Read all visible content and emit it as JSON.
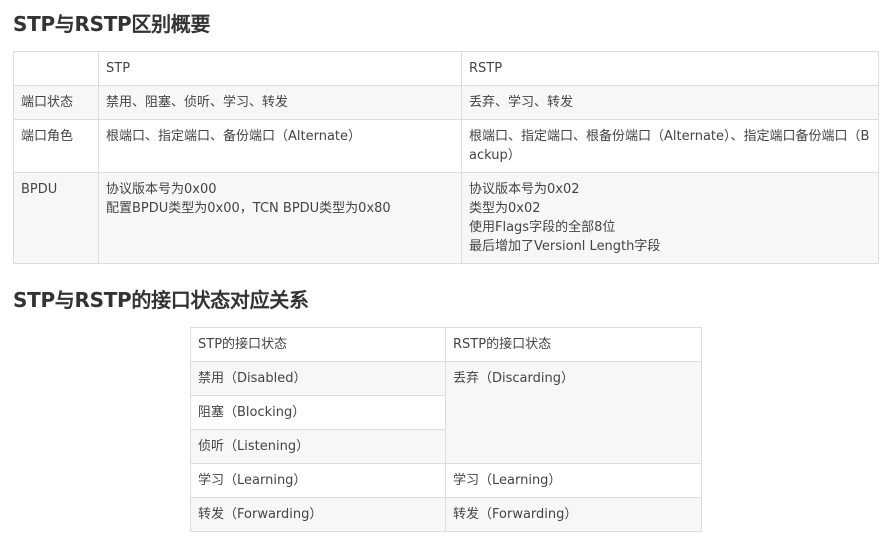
{
  "title1": "STP与RSTP区别概要",
  "title2": "STP与RSTP的接口状态对应关系",
  "table1": {
    "header": [
      "",
      "STP",
      "RSTP"
    ],
    "rows": [
      {
        "label": "端口状态",
        "stp": [
          "禁用、阻塞、侦听、学习、转发"
        ],
        "rstp": [
          "丢弃、学习、转发"
        ]
      },
      {
        "label": "端口角色",
        "stp": [
          "根端口、指定端口、备份端口（Alternate）"
        ],
        "rstp": [
          "根端口、指定端口、根备份端口（Alternate）、指定端口备份端口（Backup）"
        ]
      },
      {
        "label": "BPDU",
        "stp": [
          "协议版本号为0x00",
          "配置BPDU类型为0x00，TCN BPDU类型为0x80"
        ],
        "rstp": [
          "协议版本号为0x02",
          "类型为0x02",
          "使用Flags字段的全部8位",
          "最后增加了Versionl Length字段"
        ]
      }
    ]
  },
  "table2": {
    "header": [
      "STP的接口状态",
      "RSTP的接口状态"
    ],
    "stp_states": [
      "禁用（Disabled）",
      "阻塞（Blocking）",
      "侦听（Listening）",
      "学习（Learning）",
      "转发（Forwarding）"
    ],
    "rstp_states": [
      "丢弃（Discarding）",
      "学习（Learning）",
      "转发（Forwarding）"
    ]
  }
}
